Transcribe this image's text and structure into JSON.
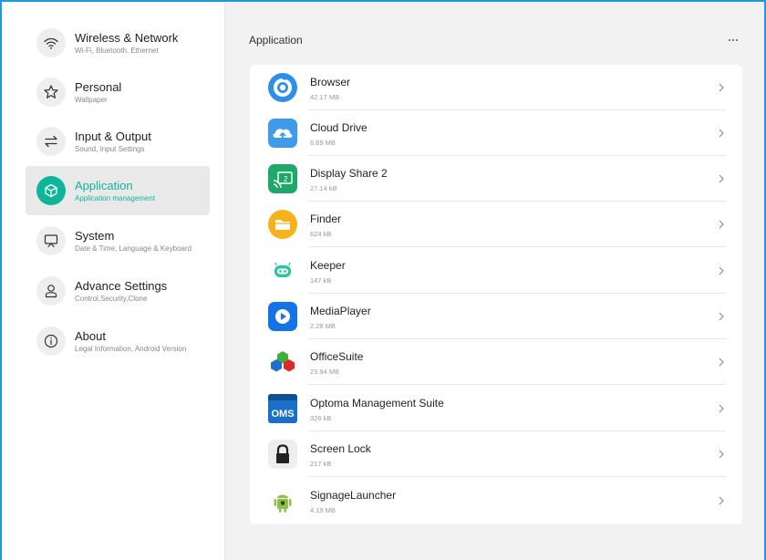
{
  "sidebar": {
    "items": [
      {
        "title": "Wireless & Network",
        "subtitle": "Wi-Fi, Bluetooth, Ethernet",
        "icon": "wifi-icon"
      },
      {
        "title": "Personal",
        "subtitle": "Wallpaper",
        "icon": "star-icon"
      },
      {
        "title": "Input & Output",
        "subtitle": "Sound, Input Settings",
        "icon": "swap-arrows-icon"
      },
      {
        "title": "Application",
        "subtitle": "Application management",
        "icon": "cube-icon",
        "active": true
      },
      {
        "title": "System",
        "subtitle": "Date & Time, Language & Keyboard",
        "icon": "monitor-icon"
      },
      {
        "title": "Advance Settings",
        "subtitle": "Control,Security,Clone",
        "icon": "user-icon"
      },
      {
        "title": "About",
        "subtitle": "Legal Information, Android Version",
        "icon": "info-icon"
      }
    ]
  },
  "header": {
    "title": "Application",
    "more_icon": "more-horizontal-icon"
  },
  "apps": [
    {
      "name": "Browser",
      "size": "42.17 MB",
      "icon": "browser-icon"
    },
    {
      "name": "Cloud Drive",
      "size": "6.69 MB",
      "icon": "cloud-drive-icon"
    },
    {
      "name": "Display Share 2",
      "size": "27.14 kB",
      "icon": "display-share-icon"
    },
    {
      "name": "Finder",
      "size": "624 kB",
      "icon": "finder-folder-icon"
    },
    {
      "name": "Keeper",
      "size": "147 kB",
      "icon": "keeper-robot-icon"
    },
    {
      "name": "MediaPlayer",
      "size": "2.28 MB",
      "icon": "media-player-icon"
    },
    {
      "name": "OfficeSuite",
      "size": "23.94 MB",
      "icon": "officesuite-icon"
    },
    {
      "name": "Optoma Management Suite",
      "size": "326 kB",
      "icon": "oms-icon",
      "icon_text": "OMS"
    },
    {
      "name": "Screen Lock",
      "size": "217 kB",
      "icon": "lock-icon"
    },
    {
      "name": "SignageLauncher",
      "size": "4.19 MB",
      "icon": "android-icon"
    }
  ],
  "colors": {
    "accent": "#0fb59a",
    "frame": "#1e9be0",
    "background": "#f2f2f2"
  }
}
